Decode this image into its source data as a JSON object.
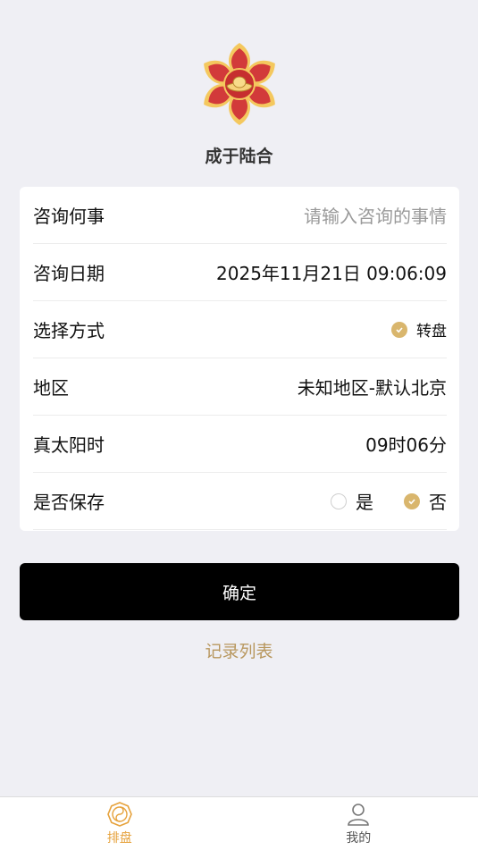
{
  "brand": {
    "title": "成于陆合",
    "logo_icon": "lotus-ingot-logo-icon"
  },
  "form": {
    "matter": {
      "label": "咨询何事",
      "placeholder": "请输入咨询的事情"
    },
    "date": {
      "label": "咨询日期",
      "value": "2025年11月21日 09:06:09"
    },
    "method": {
      "label": "选择方式",
      "option": "转盘",
      "checked": true
    },
    "region": {
      "label": "地区",
      "value": "未知地区-默认北京"
    },
    "solar_time": {
      "label": "真太阳时",
      "value": "09时06分"
    },
    "save": {
      "label": "是否保存",
      "yes": "是",
      "no": "否",
      "selected": "否"
    }
  },
  "actions": {
    "confirm": "确定",
    "records": "记录列表"
  },
  "tabbar": {
    "items": [
      {
        "label": "排盘",
        "icon": "bagua-icon",
        "active": true
      },
      {
        "label": "我的",
        "icon": "user-icon",
        "active": false
      }
    ]
  },
  "colors": {
    "accent": "#d9b66d",
    "link": "#b8975e",
    "tab_active": "#e6a23c",
    "tab_inactive": "#555555",
    "button": "#000000",
    "background": "#efeff4"
  }
}
